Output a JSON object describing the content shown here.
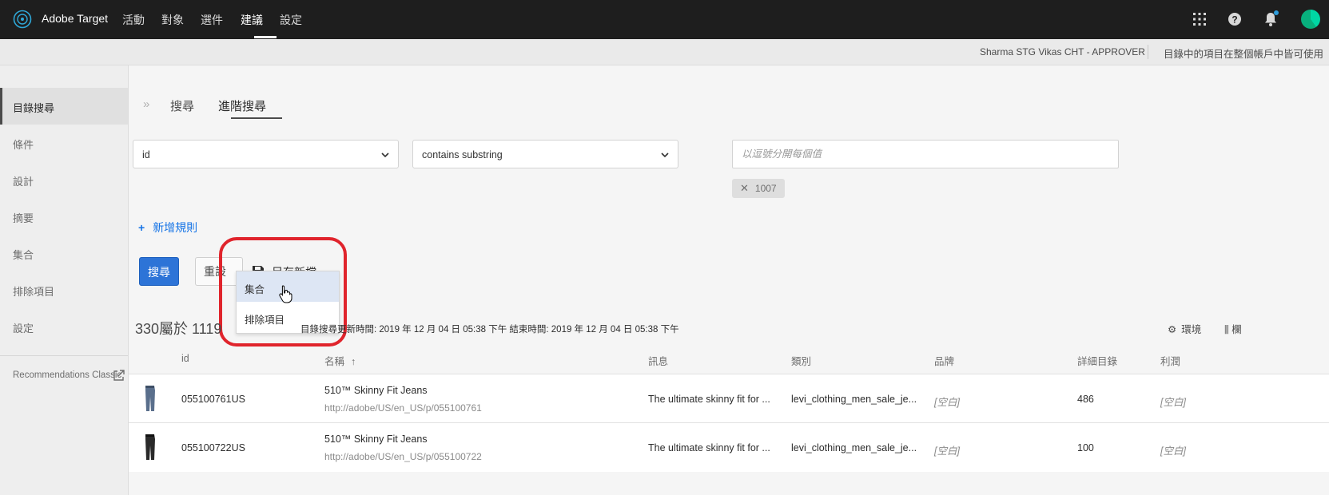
{
  "app": {
    "title": "Adobe Target"
  },
  "nav": {
    "items": [
      "活動",
      "對象",
      "選件",
      "建議",
      "設定"
    ],
    "active_index": 3
  },
  "subheader": {
    "user": "Sharma STG Vikas CHT - APPROVER",
    "note": "目錄中的項目在整個帳戶中皆可使用"
  },
  "sidebar": {
    "items": [
      "目錄搜尋",
      "條件",
      "設計",
      "摘要",
      "集合",
      "排除項目",
      "設定"
    ],
    "active_index": 0,
    "classic_link": "Recommendations Classic"
  },
  "tabs": {
    "items": [
      "搜尋",
      "進階搜尋"
    ],
    "active_index": 1
  },
  "filter": {
    "field": "id",
    "operator": "contains substring",
    "value_placeholder": "以逗號分開每個值",
    "tag": "1007"
  },
  "actions": {
    "add_rule": "新增規則",
    "search": "搜尋",
    "reset": "重設",
    "save_as": "另存新檔...",
    "menu": [
      "集合",
      "排除項目"
    ],
    "hovered_menu_index": 0
  },
  "results": {
    "count_text": "330屬於 1119",
    "updated_text": "目錄搜尋更新時間: 2019 年 12 月 04 日 05:38 下午 結束時間: 2019 年 12 月 04 日 05:38 下午",
    "env_label": "環境",
    "columns_label": "欄"
  },
  "table": {
    "headers": [
      "id",
      "名稱",
      "訊息",
      "類別",
      "品牌",
      "詳細目錄",
      "利潤"
    ],
    "rows": [
      {
        "id": "055100761US",
        "name": "510™ Skinny Fit Jeans",
        "url": "http://adobe/US/en_US/p/055100761",
        "message": "The ultimate skinny fit for ...",
        "category": "levi_clothing_men_sale_je...",
        "brand": "[空白]",
        "inventory": "486",
        "margin": "[空白]"
      },
      {
        "id": "055100722US",
        "name": "510™ Skinny Fit Jeans",
        "url": "http://adobe/US/en_US/p/055100722",
        "message": "The ultimate skinny fit for ...",
        "category": "levi_clothing_men_sale_je...",
        "brand": "[空白]",
        "inventory": "100",
        "margin": "[空白]"
      }
    ]
  },
  "colors": {
    "primary": "#2d74d7",
    "link": "#1473e6",
    "nav_bg": "#1e1e1e",
    "highlight": "#e0242c"
  }
}
